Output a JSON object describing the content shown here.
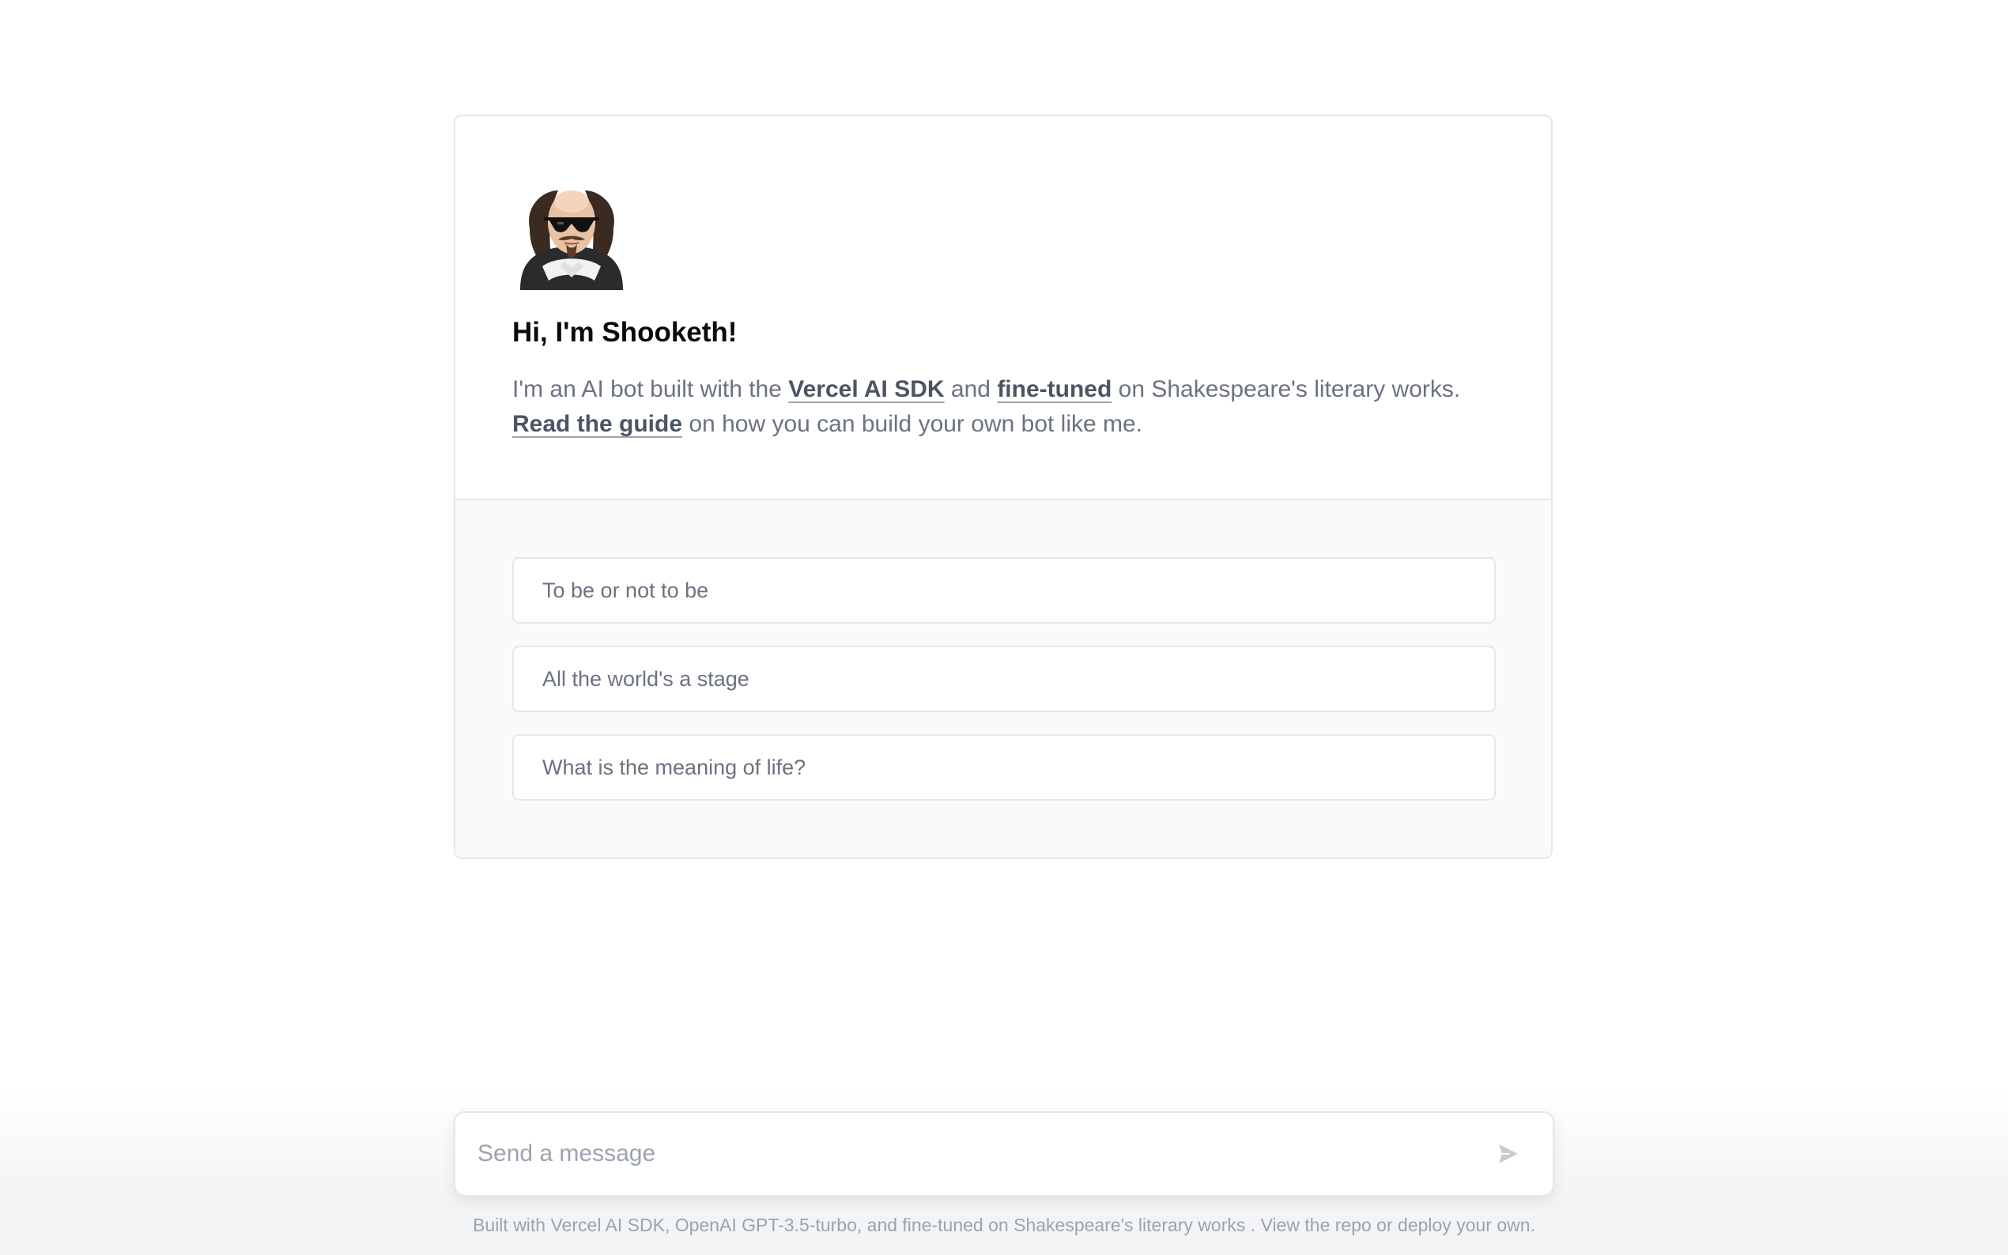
{
  "intro": {
    "avatar_icon": "shakespeare-with-sunglasses-avatar",
    "title": "Hi, I'm Shooketh!",
    "line1_prefix": "I'm an AI bot built with the ",
    "link_vercel_sdk": "Vercel AI SDK",
    "line1_and": " and ",
    "link_fine_tuned": "fine-tuned",
    "line1_suffix": " on Shakespeare's literary works.",
    "link_read_guide": "Read the guide",
    "line2_suffix": " on how you can build your own bot like me."
  },
  "examples": [
    "To be or not to be",
    "All the world's a stage",
    "What is the meaning of life?"
  ],
  "composer": {
    "placeholder": "Send a message",
    "send_icon": "send-arrow-icon"
  },
  "footer": {
    "prefix": "Built with ",
    "link_vercel_sdk": "Vercel AI SDK",
    "sep1": ", ",
    "link_openai": "OpenAI GPT-3.5-turbo",
    "sep2": ", and ",
    "link_fine_tuned": "fine-tuned",
    "middle": " on Shakespeare's literary works . ",
    "link_view_repo": "View the repo",
    "or": " or ",
    "link_deploy": "deploy your own",
    "end": "."
  },
  "colors": {
    "text_muted": "#6b7280",
    "title": "#0a0a0a",
    "border": "#e5e7eb",
    "panel_bg": "#fafafa"
  }
}
